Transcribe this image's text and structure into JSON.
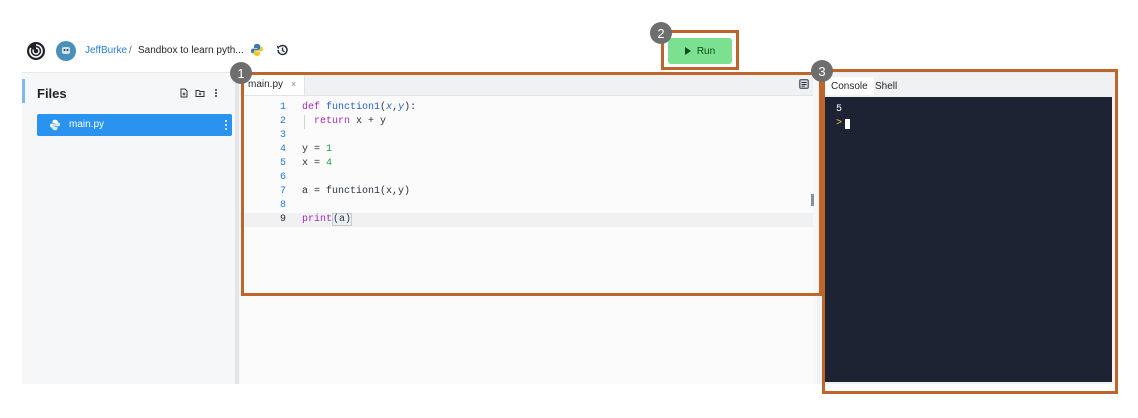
{
  "header": {
    "user": "JeffBurke",
    "separator": "/",
    "repl_name": "Sandbox to learn pyth...",
    "run_label": "Run"
  },
  "sidebar": {
    "title": "Files",
    "files": [
      {
        "name": "main.py",
        "icon": "python-icon"
      }
    ]
  },
  "editor": {
    "tab": {
      "label": "main.py",
      "close": "×"
    },
    "lines": [
      {
        "number": "1",
        "text": "def function1(x,y):"
      },
      {
        "number": "2",
        "text": "  return x + y"
      },
      {
        "number": "3",
        "text": ""
      },
      {
        "number": "4",
        "text": "y = 1"
      },
      {
        "number": "5",
        "text": "x = 4"
      },
      {
        "number": "6",
        "text": ""
      },
      {
        "number": "7",
        "text": "a = function1(x,y)"
      },
      {
        "number": "8",
        "text": ""
      },
      {
        "number": "9",
        "text": "print(a)"
      }
    ],
    "active_line": "9"
  },
  "console": {
    "tabs": [
      "Console",
      "Shell"
    ],
    "active_tab": "Console",
    "output": "5",
    "prompt": ">"
  },
  "annotations": [
    {
      "label": "1",
      "target": "editor"
    },
    {
      "label": "2",
      "target": "run-button"
    },
    {
      "label": "3",
      "target": "console"
    }
  ],
  "colors": {
    "run_button": "#7be08f",
    "selected_file": "#2a93f0",
    "terminal_bg": "#1d2333",
    "annotation_border": "#c0652a",
    "annotation_badge": "#6e6e6e"
  }
}
